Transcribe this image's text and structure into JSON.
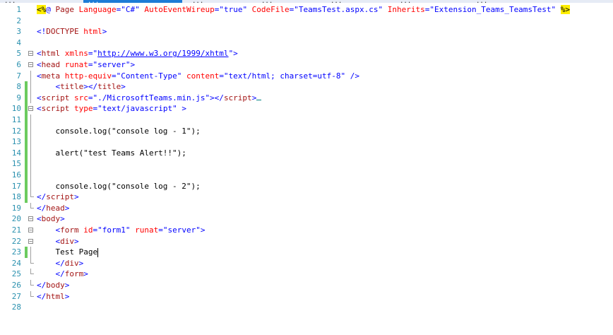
{
  "tabs": [
    {
      "label": "...",
      "active": false
    },
    {
      "label": "...",
      "active": true
    },
    {
      "label": "...",
      "active": false
    },
    {
      "label": "...",
      "active": false
    },
    {
      "label": "...",
      "active": false
    },
    {
      "label": "...",
      "active": false
    },
    {
      "label": "...",
      "active": false
    }
  ],
  "colors": {
    "line_number": "#2b91af",
    "tag": "#0000ff",
    "element": "#a31515",
    "attribute": "#ff0000",
    "string": "#0000ff",
    "directive_highlight": "#ffee00",
    "change_bar": "#6ccb5f"
  },
  "lines": [
    {
      "n": "1",
      "fold": "",
      "changed": false,
      "tokens": [
        {
          "c": "hl",
          "t": "<%"
        },
        {
          "c": "blue",
          "t": "@ "
        },
        {
          "c": "maroon",
          "t": "Page"
        },
        {
          "c": "red",
          "t": " Language"
        },
        {
          "c": "blue",
          "t": "=\"C#\""
        },
        {
          "c": "red",
          "t": " AutoEventWireup"
        },
        {
          "c": "blue",
          "t": "=\"true\""
        },
        {
          "c": "red",
          "t": " CodeFile"
        },
        {
          "c": "blue",
          "t": "=\"TeamsTest.aspx.cs\""
        },
        {
          "c": "red",
          "t": " Inherits"
        },
        {
          "c": "blue",
          "t": "=\"Extension_Teams_TeamsTest\" "
        },
        {
          "c": "hl",
          "t": "%>"
        }
      ]
    },
    {
      "n": "2",
      "fold": "",
      "changed": false,
      "tokens": []
    },
    {
      "n": "3",
      "fold": "",
      "changed": false,
      "tokens": [
        {
          "c": "blue",
          "t": "<!"
        },
        {
          "c": "maroon",
          "t": "DOCTYPE"
        },
        {
          "c": "red",
          "t": " html"
        },
        {
          "c": "blue",
          "t": ">"
        }
      ]
    },
    {
      "n": "4",
      "fold": "",
      "changed": false,
      "tokens": []
    },
    {
      "n": "5",
      "fold": "open",
      "changed": false,
      "tokens": [
        {
          "c": "blue",
          "t": "<"
        },
        {
          "c": "maroon",
          "t": "html"
        },
        {
          "c": "red",
          "t": " xmlns"
        },
        {
          "c": "blue",
          "t": "=\""
        },
        {
          "c": "link",
          "t": "http://www.w3.org/1999/xhtml"
        },
        {
          "c": "blue",
          "t": "\">"
        }
      ]
    },
    {
      "n": "6",
      "fold": "open",
      "changed": false,
      "tokens": [
        {
          "c": "blue",
          "t": "<"
        },
        {
          "c": "maroon",
          "t": "head"
        },
        {
          "c": "red",
          "t": " runat"
        },
        {
          "c": "blue",
          "t": "=\"server\">"
        }
      ]
    },
    {
      "n": "7",
      "fold": "line",
      "changed": false,
      "tokens": [
        {
          "c": "blue",
          "t": "<"
        },
        {
          "c": "maroon",
          "t": "meta"
        },
        {
          "c": "red",
          "t": " http-equiv"
        },
        {
          "c": "blue",
          "t": "=\"Content-Type\""
        },
        {
          "c": "red",
          "t": " content"
        },
        {
          "c": "blue",
          "t": "=\"text/html; charset=utf-8\" />"
        }
      ]
    },
    {
      "n": "8",
      "fold": "line",
      "changed": true,
      "tokens": [
        {
          "c": "blue",
          "t": "    <"
        },
        {
          "c": "maroon",
          "t": "title"
        },
        {
          "c": "blue",
          "t": "></"
        },
        {
          "c": "maroon",
          "t": "title"
        },
        {
          "c": "blue",
          "t": ">"
        }
      ]
    },
    {
      "n": "9",
      "fold": "line",
      "changed": true,
      "squiggle": true,
      "tokens": [
        {
          "c": "blue",
          "t": "<"
        },
        {
          "c": "maroon",
          "t": "script"
        },
        {
          "c": "red",
          "t": " src"
        },
        {
          "c": "blue",
          "t": "=\"./MicrosoftTeams.min.js\"></"
        },
        {
          "c": "maroon",
          "t": "script"
        },
        {
          "c": "blue",
          "t": ">"
        }
      ]
    },
    {
      "n": "10",
      "fold": "open",
      "changed": true,
      "tokens": [
        {
          "c": "blue",
          "t": "<"
        },
        {
          "c": "maroon",
          "t": "script"
        },
        {
          "c": "red",
          "t": " type"
        },
        {
          "c": "blue",
          "t": "=\"text/javascript\" >"
        }
      ]
    },
    {
      "n": "11",
      "fold": "line",
      "changed": true,
      "tokens": []
    },
    {
      "n": "12",
      "fold": "line",
      "changed": true,
      "tokens": [
        {
          "c": "black",
          "t": "    console.log(\"console log - 1\");"
        }
      ]
    },
    {
      "n": "13",
      "fold": "line",
      "changed": true,
      "tokens": []
    },
    {
      "n": "14",
      "fold": "line",
      "changed": true,
      "tokens": [
        {
          "c": "black",
          "t": "    alert(\"test Teams Alert!!\");"
        }
      ]
    },
    {
      "n": "15",
      "fold": "line",
      "changed": true,
      "tokens": []
    },
    {
      "n": "16",
      "fold": "line",
      "changed": true,
      "tokens": []
    },
    {
      "n": "17",
      "fold": "line",
      "changed": true,
      "tokens": [
        {
          "c": "black",
          "t": "    console.log(\"console log - 2\");"
        }
      ]
    },
    {
      "n": "18",
      "fold": "end",
      "changed": true,
      "tokens": [
        {
          "c": "blue",
          "t": "</"
        },
        {
          "c": "maroon",
          "t": "script"
        },
        {
          "c": "blue",
          "t": ">"
        }
      ]
    },
    {
      "n": "19",
      "fold": "end",
      "changed": false,
      "tokens": [
        {
          "c": "blue",
          "t": "</"
        },
        {
          "c": "maroon",
          "t": "head"
        },
        {
          "c": "blue",
          "t": ">"
        }
      ]
    },
    {
      "n": "20",
      "fold": "open",
      "changed": false,
      "tokens": [
        {
          "c": "blue",
          "t": "<"
        },
        {
          "c": "maroon",
          "t": "body"
        },
        {
          "c": "blue",
          "t": ">"
        }
      ]
    },
    {
      "n": "21",
      "fold": "open",
      "changed": false,
      "tokens": [
        {
          "c": "blue",
          "t": "    <"
        },
        {
          "c": "maroon",
          "t": "form"
        },
        {
          "c": "red",
          "t": " id"
        },
        {
          "c": "blue",
          "t": "=\"form1\""
        },
        {
          "c": "red",
          "t": " runat"
        },
        {
          "c": "blue",
          "t": "=\"server\">"
        }
      ]
    },
    {
      "n": "22",
      "fold": "open",
      "changed": false,
      "tokens": [
        {
          "c": "blue",
          "t": "    <"
        },
        {
          "c": "maroon",
          "t": "div"
        },
        {
          "c": "blue",
          "t": ">"
        }
      ]
    },
    {
      "n": "23",
      "fold": "line",
      "changed": true,
      "cursor": true,
      "tokens": [
        {
          "c": "black",
          "t": "    Test Page"
        }
      ]
    },
    {
      "n": "24",
      "fold": "end",
      "changed": false,
      "tokens": [
        {
          "c": "blue",
          "t": "    </"
        },
        {
          "c": "maroon",
          "t": "div"
        },
        {
          "c": "blue",
          "t": ">"
        }
      ]
    },
    {
      "n": "25",
      "fold": "end",
      "changed": false,
      "tokens": [
        {
          "c": "blue",
          "t": "    </"
        },
        {
          "c": "maroon",
          "t": "form"
        },
        {
          "c": "blue",
          "t": ">"
        }
      ]
    },
    {
      "n": "26",
      "fold": "end",
      "changed": false,
      "tokens": [
        {
          "c": "blue",
          "t": "</"
        },
        {
          "c": "maroon",
          "t": "body"
        },
        {
          "c": "blue",
          "t": ">"
        }
      ]
    },
    {
      "n": "27",
      "fold": "end",
      "changed": false,
      "tokens": [
        {
          "c": "blue",
          "t": "</"
        },
        {
          "c": "maroon",
          "t": "html"
        },
        {
          "c": "blue",
          "t": ">"
        }
      ]
    },
    {
      "n": "28",
      "fold": "",
      "changed": false,
      "tokens": []
    }
  ]
}
